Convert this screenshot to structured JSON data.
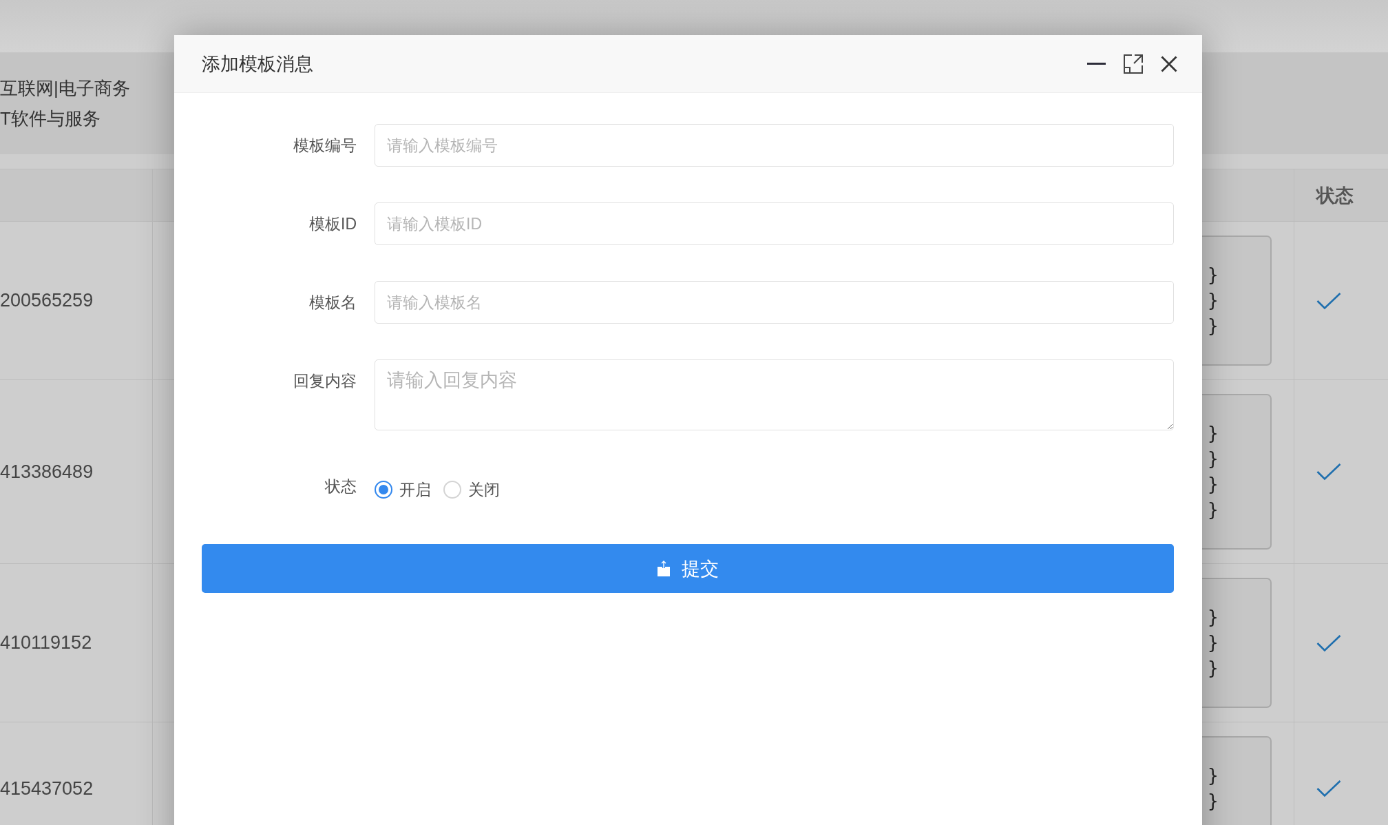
{
  "background": {
    "info_lines": [
      "互联网|电子商务",
      "T软件与服务"
    ],
    "table": {
      "status_header": "状态",
      "rows": [
        {
          "column_1": "200565259",
          "column_2": [
            "}",
            "}",
            "}"
          ],
          "status_on": true
        },
        {
          "column_1": "413386489",
          "column_2": [
            "}",
            "}",
            "}",
            "}"
          ],
          "status_on": true
        },
        {
          "column_1": "410119152",
          "column_2": [
            "}",
            "}",
            "}"
          ],
          "status_on": true
        },
        {
          "column_1": "415437052",
          "column_2": [
            "}",
            "}"
          ],
          "status_on": true
        }
      ]
    }
  },
  "dialog": {
    "title": "添加模板消息",
    "fields": [
      {
        "kind": "input",
        "label": "模板编号",
        "placeholder": "请输入模板编号"
      },
      {
        "kind": "input",
        "label": "模板ID",
        "placeholder": "请输入模板ID"
      },
      {
        "kind": "input",
        "label": "模板名",
        "placeholder": "请输入模板名"
      },
      {
        "kind": "textarea",
        "label": "回复内容",
        "placeholder": "请输入回复内容"
      }
    ],
    "status": {
      "label": "状态",
      "options": [
        {
          "label": "开启",
          "selected": true
        },
        {
          "label": "关闭",
          "selected": false
        }
      ]
    },
    "submit_button": "提交"
  }
}
